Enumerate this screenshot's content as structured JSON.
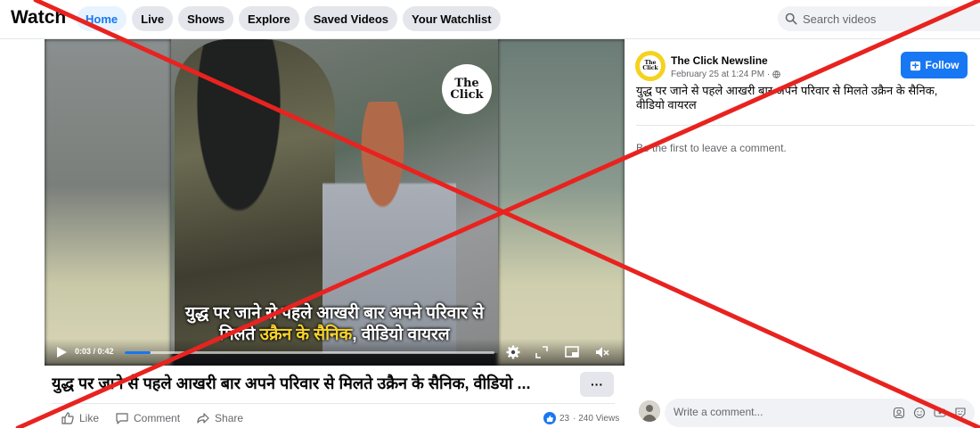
{
  "nav": {
    "brand": "Watch",
    "tabs": [
      {
        "label": "Home",
        "active": true
      },
      {
        "label": "Live",
        "active": false
      },
      {
        "label": "Shows",
        "active": false
      },
      {
        "label": "Explore",
        "active": false
      },
      {
        "label": "Saved Videos",
        "active": false
      },
      {
        "label": "Your Watchlist",
        "active": false
      }
    ],
    "search_placeholder": "Search videos"
  },
  "video": {
    "logo_text": "The\nClick",
    "caption_line1": "युद्ध पर जाने से पहले आखरी बार अपने परिवार से",
    "caption_line2_prefix": "मिलते ",
    "caption_line2_highlight": "उक्रैन के सैनिक",
    "caption_line2_suffix": ", वीडियो वायरल",
    "time": "0:03 / 0:42",
    "progress": 0.07,
    "title": "युद्ध पर जाने से पहले आखरी बार अपने परिवार से मिलते उक्रैन के सैनिक, वीडियो ...",
    "more_label": "···",
    "actions": {
      "like": "Like",
      "comment": "Comment",
      "share": "Share"
    },
    "reactions_count": "23",
    "views": "· 240 Views"
  },
  "post": {
    "page_name": "The Click Newsline",
    "avatar_text": "The\nClick",
    "date": "February 25 at 1:24 PM ·",
    "follow_label": "Follow",
    "text": "युद्ध पर जाने से पहले आखरी बार अपने परिवार से मिलते उक्रैन के सैनिक, वीडियो वायरल",
    "empty_comments": "Be the first to leave a comment.",
    "comment_placeholder": "Write a comment..."
  },
  "colors": {
    "accent": "#1877f2",
    "overlay_cross": "#e8231f",
    "caption_highlight": "#f6d32c"
  }
}
